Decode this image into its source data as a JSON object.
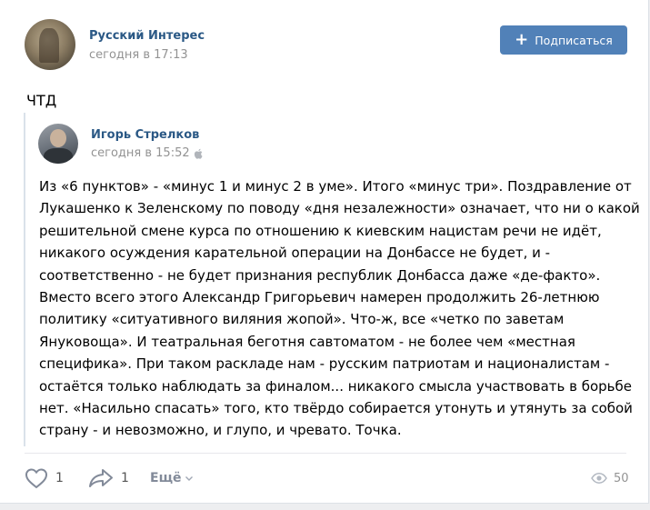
{
  "post": {
    "author": {
      "name": "Русский Интерес",
      "time": "сегодня в 17:13"
    },
    "subscribe_button": {
      "icon": "plus-icon",
      "plus": "+",
      "label": "Подписаться"
    },
    "text": "ЧТД",
    "repost": {
      "author": {
        "name": "Игорь Стрелков",
        "time": "сегодня в 15:52",
        "platform_icon": "apple-icon"
      },
      "lines": [
        "Из «6 пунктов» - «минус 1 и минус 2 в уме». Итого «минус три». Поздравление от",
        "Лукашенко к Зеленскому по поводу «дня незалежности» означает, что ни о какой",
        "решительной смене курса по отношению к киевским нацистам речи не идёт,",
        "никакого осуждения карательной операции на Донбассе не будет, и -",
        "соответственно - не будет признания республик Донбасса даже «де-факто».",
        "Вместо всего этого Александр Григорьевич намерен продолжить 26-летнюю",
        "политику «ситуативного виляния жопой». Что-ж, все «четко по заветам",
        "Януковоща». И театральная беготня савтоматом - не более чем «местная",
        "специфика». При таком раскладе нам - русским патриотам и националистам -",
        "остаётся только наблюдать за финалом... никакого смысла участвовать в борьбе",
        "нет. «Насильно спасать» того, кто твёрдо собирается утонуть и утянуть за собой",
        "страну - и невозможно, и глупо, и чревато. Точка."
      ]
    },
    "actions": {
      "like": {
        "icon": "heart-icon",
        "count": "1"
      },
      "share": {
        "icon": "share-arrow-icon",
        "count": "1"
      },
      "more": {
        "label": "Ещё",
        "icon": "chevron-down-icon"
      },
      "views": {
        "icon": "eye-icon",
        "count": "50"
      }
    },
    "colors": {
      "link": "#2a5885",
      "button": "#5181b8",
      "muted": "#939393",
      "icon": "#828a99"
    }
  }
}
